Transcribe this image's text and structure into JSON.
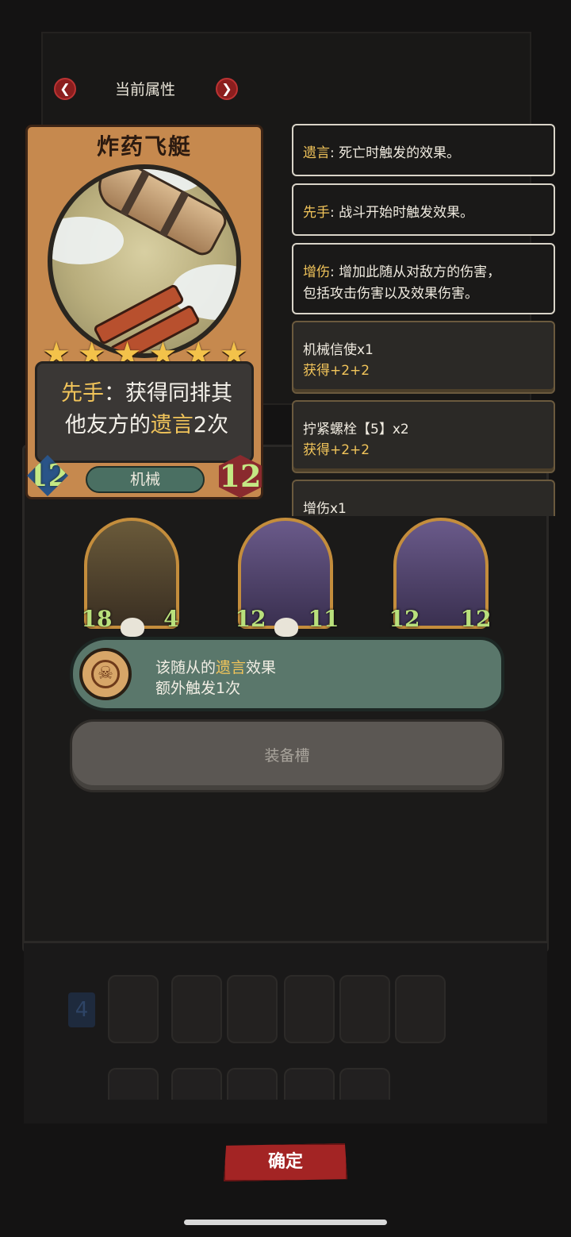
{
  "header": {
    "title": "当前属性",
    "prev_icon": "chevron-left-icon",
    "next_icon": "chevron-right-icon"
  },
  "card": {
    "name": "炸药飞艇",
    "stars": 6,
    "ability": {
      "keyword1": "先手",
      "text1": "：获得同排其",
      "text2": "他友方的",
      "keyword2": "遗言",
      "text3": "2次"
    },
    "attack": "12",
    "health": "12",
    "tribe": "机械"
  },
  "keywords": [
    {
      "name": "遗言",
      "desc": ": 死亡时触发的效果。"
    },
    {
      "name": "先手",
      "desc": ": 战斗开始时触发效果。"
    },
    {
      "name": "增伤",
      "desc": ": 增加此随从对敌方的伤害，",
      "desc2": "包括攻击伤害以及效果伤害。"
    }
  ],
  "buffs": [
    {
      "name": "机械信使x1",
      "gain": "获得+2+2"
    },
    {
      "name": "拧紧螺栓【5】x2",
      "gain": "获得+2+2"
    },
    {
      "name": "增伤x1",
      "gain": ""
    }
  ],
  "minions": [
    {
      "attack": "18",
      "health": "4"
    },
    {
      "attack": "12",
      "health": "11"
    },
    {
      "attack": "12",
      "health": "12"
    }
  ],
  "tooltip": {
    "icon": "skull-medallion-icon",
    "line1_pre": "该随从的",
    "line1_kw": "遗言",
    "line1_post": "效果",
    "line2": "额外触发1次"
  },
  "equip_slot": "装备槽",
  "confirm_label": "确定",
  "colors": {
    "keyword": "#f1c45a",
    "stat_text": "#c4e884",
    "confirm_bg": "#a32424",
    "tooltip_bg": "#5a776b"
  }
}
